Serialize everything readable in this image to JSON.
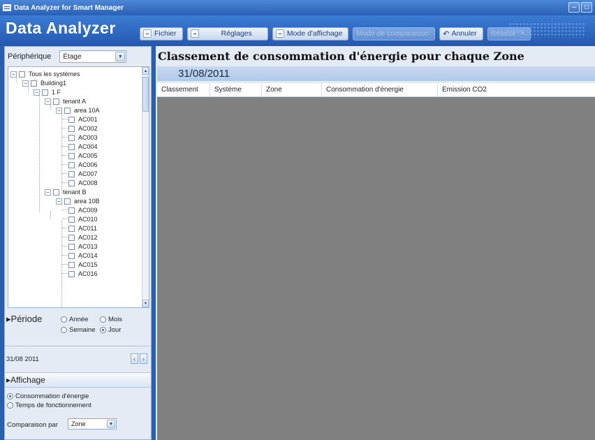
{
  "window": {
    "title": "Data Analyzer for Smart Manager",
    "app_icon": "monitor-icon",
    "buttons": [
      "minimize-icon",
      "maximize-icon"
    ]
  },
  "header": {
    "brand": "Data Analyzer",
    "toolbar": {
      "fichier": "Fichier",
      "reglages": "Réglages",
      "mode_affichage": "Mode d'affichage",
      "mode_comparaison": "Mode de comparaison",
      "annuler": "Annuler",
      "retablir": "Rétablir"
    }
  },
  "left": {
    "device_label": "Périphérique",
    "device_combo": "Étage",
    "tree": {
      "root": "Tous les systèmes",
      "building": "Building1",
      "floor": "1 F",
      "tenant_a": "tenant A",
      "area_a": "area 10A",
      "units_a": [
        "AC001",
        "AC002",
        "AC003",
        "AC004",
        "AC005",
        "AC006",
        "AC007",
        "AC008"
      ],
      "tenant_b": "tenant B",
      "area_b": "area 10B",
      "units_b": [
        "AC009",
        "AC010",
        "AC011",
        "AC012",
        "AC013",
        "AC014",
        "AC015",
        "AC016"
      ]
    },
    "periode": {
      "title": "▸Période",
      "annee": "Année",
      "mois": "Mois",
      "semaine": "Semaine",
      "jour": "Jour",
      "selected": "Jour"
    },
    "date": "31/08 2011",
    "affichage": {
      "title": "▸Affichage",
      "opt1": "Consommation d'énergie",
      "opt2": "Temps de fonctionnement",
      "selected": "Consommation d'énergie",
      "comparaison_label": "Comparaison par",
      "comparaison_value": "Zone"
    }
  },
  "main": {
    "title": "Classement de consommation d'énergie pour chaque Zone",
    "date": "31/08/2011",
    "columns": [
      "Classement",
      "Système",
      "Zone",
      "Consommation d'énergie",
      "Emission CO2"
    ]
  },
  "colors": {
    "titlebar": "#2a60b5",
    "header": "#2558ae",
    "panel": "#e4ebf5",
    "grid_bg": "#808080",
    "date_band": "#b0c8ea"
  }
}
